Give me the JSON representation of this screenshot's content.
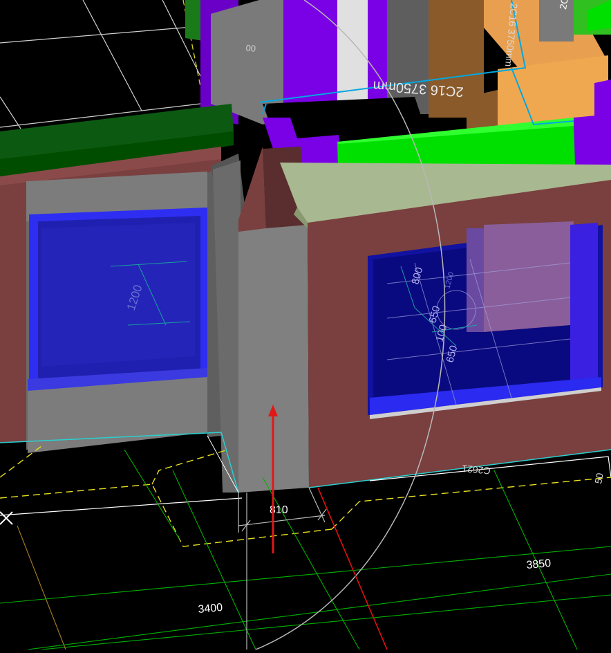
{
  "app": {
    "view_name": "3D building model viewport"
  },
  "colors": {
    "background": "#000000",
    "wall": "#7a3f3f",
    "column": "#808080",
    "window_frame": "#2e2ef2",
    "glass": "#1a1aa8",
    "beam_green": "#00e000",
    "beam_dark_green": "#0c5a12",
    "purple": "#7a00e6",
    "orange": "#e8a050",
    "rebar_line": "#00a8e0",
    "axis_red": "#e01010",
    "grid_green": "#00c000",
    "dim_yellow": "#e8e020"
  },
  "annotations": {
    "rebar_label": "2C16 3750mm",
    "rebar_label_side": "2C16 3750mm",
    "top_corner_label": "2C",
    "top_small_label": "00",
    "left_window_dim": "1200",
    "right_window_dim_800": "800",
    "right_window_dim_650_a": "650",
    "right_window_dim_100": "100",
    "right_window_dim_650_b": "650",
    "right_window_dim_small": "1200",
    "column_width_dim": "810",
    "grid_dim_left": "3400",
    "grid_dim_right": "3850",
    "floor_tag": "C2621",
    "edge_tag": "50"
  },
  "tools": {
    "move_arrow": "up-arrow-icon",
    "cursor": "crosshair-icon"
  }
}
